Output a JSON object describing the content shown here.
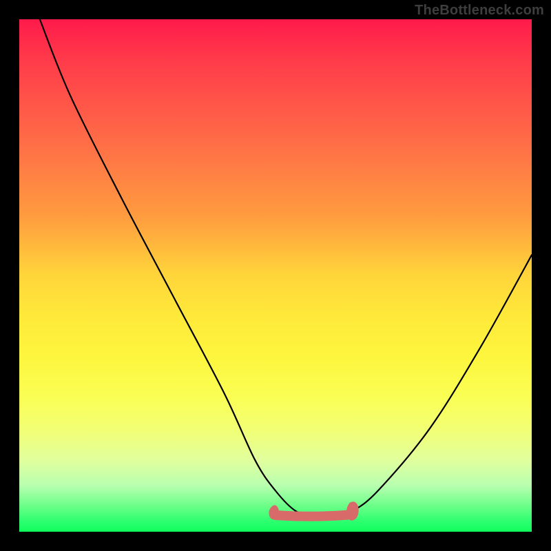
{
  "watermark": "TheBottleneck.com",
  "colors": {
    "line": "#000000",
    "accent": "#d86a6a",
    "bg_black": "#000000"
  },
  "chart_data": {
    "type": "line",
    "title": "",
    "xlabel": "",
    "ylabel": "",
    "xlim": [
      0,
      100
    ],
    "ylim": [
      0,
      100
    ],
    "grid": false,
    "note": "V-shaped bottleneck curve; y-values are read as percentage height from bottom of the colored plot area.",
    "series": [
      {
        "name": "main-curve",
        "x": [
          4,
          10,
          20,
          30,
          40,
          46,
          50,
          54,
          58,
          62,
          65,
          70,
          80,
          90,
          100
        ],
        "y": [
          100,
          85,
          65,
          46,
          27,
          14,
          8,
          4,
          3,
          3,
          4,
          8,
          20,
          36,
          54
        ]
      }
    ],
    "accent_segment": {
      "name": "flat-red-segment",
      "x_start": 50,
      "x_end": 65,
      "y_approx": 3.5,
      "color": "#d86a6a",
      "desc": "Thick salmon-colored segment along the bottom of the V with small rough end-caps."
    }
  }
}
